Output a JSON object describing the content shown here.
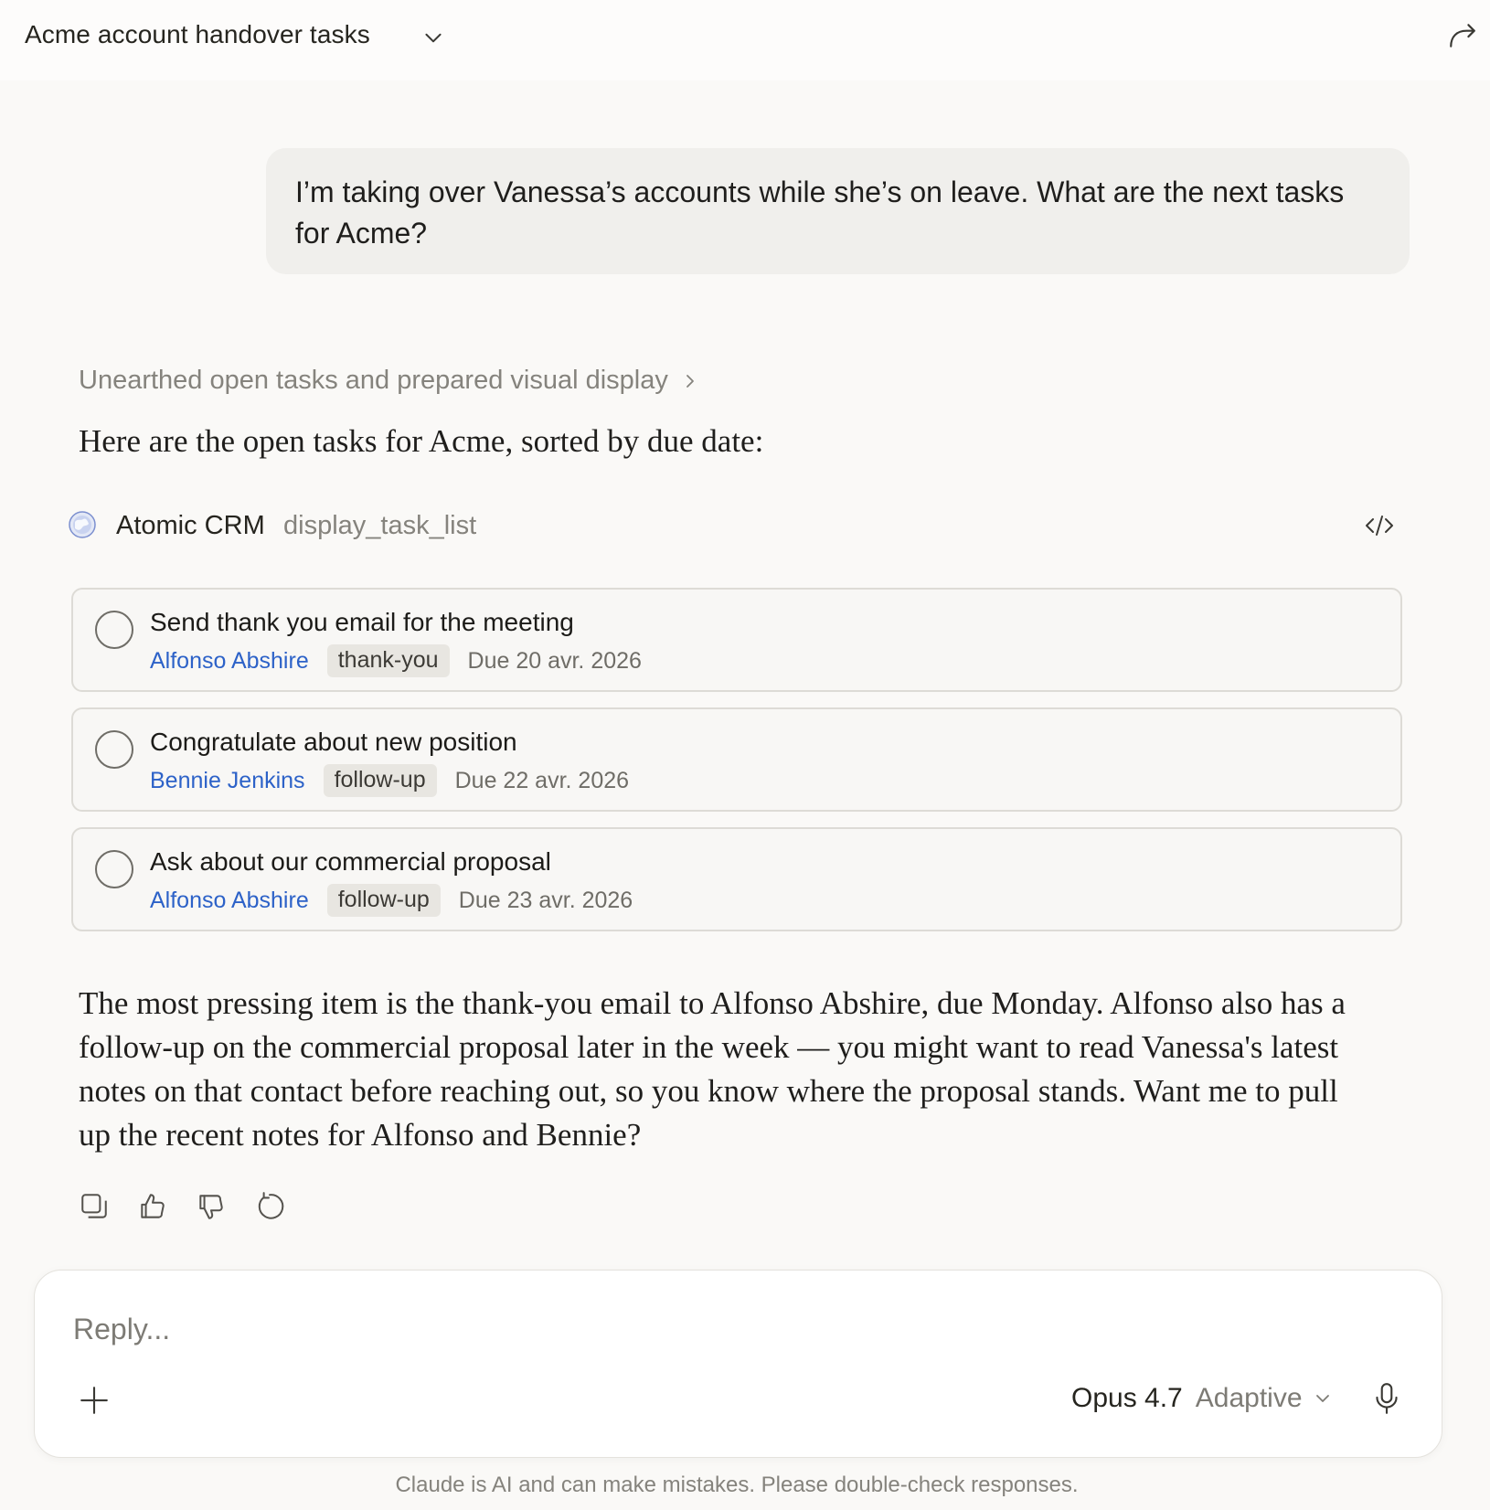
{
  "header": {
    "title": "Acme account handover tasks"
  },
  "user_message": "I’m taking over Vanessa’s accounts while she’s on leave. What are the next tasks for Acme?",
  "assistant": {
    "thinking_summary": "Unearthed open tasks and prepared visual display",
    "intro": "Here are the open tasks for Acme, sorted by due date:",
    "tool": {
      "app_name": "Atomic CRM",
      "function_name": "display_task_list"
    },
    "tasks": [
      {
        "title": "Send thank you email for the meeting",
        "contact": "Alfonso Abshire",
        "tag": "thank-you",
        "due": "Due 20 avr. 2026",
        "done": false
      },
      {
        "title": "Congratulate about new position",
        "contact": "Bennie Jenkins",
        "tag": "follow-up",
        "due": "Due 22 avr. 2026",
        "done": false
      },
      {
        "title": "Ask about our commercial proposal",
        "contact": "Alfonso Abshire",
        "tag": "follow-up",
        "due": "Due 23 avr. 2026",
        "done": false
      }
    ],
    "summary": "The most pressing item is the thank-you email to Alfonso Abshire, due Monday. Alfonso also has a follow-up on the commercial proposal later in the week — you might want to read Vanessa's latest notes on that contact before reaching out, so you know where the proposal stands. Want me to pull up the recent notes for Alfonso and Bennie?",
    "action_icons": [
      "copy-icon",
      "thumbs-up-icon",
      "thumbs-down-icon",
      "retry-icon"
    ]
  },
  "composer": {
    "placeholder": "Reply...",
    "model_name": "Opus 4.7",
    "model_mode": "Adaptive"
  },
  "footer": {
    "disclaimer": "Claude is AI and can make mistakes. Please double-check responses."
  },
  "colors": {
    "background": "#faf9f7",
    "contact_link": "#2d62c8",
    "bubble": "#f0efec",
    "tag_bg": "#e8e6e1"
  }
}
